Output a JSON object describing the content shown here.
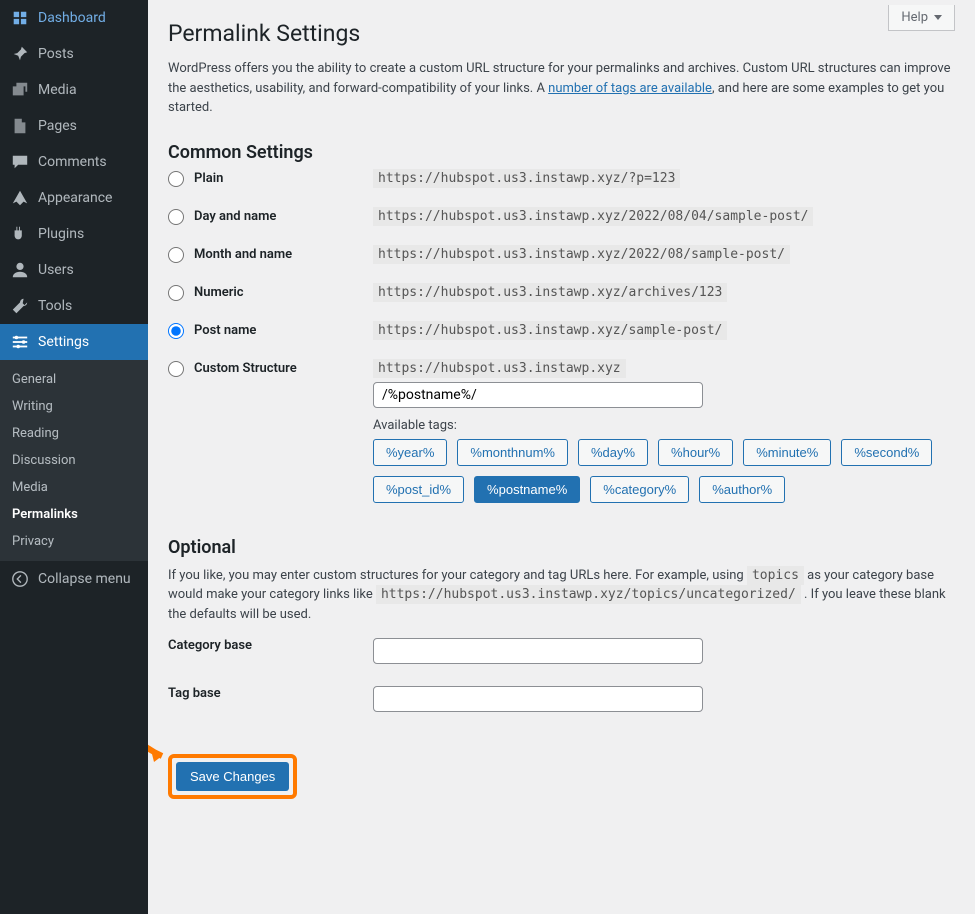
{
  "sidebar": {
    "items": [
      {
        "label": "Dashboard",
        "icon": "dashboard"
      },
      {
        "label": "Posts",
        "icon": "pin"
      },
      {
        "label": "Media",
        "icon": "media"
      },
      {
        "label": "Pages",
        "icon": "pages"
      },
      {
        "label": "Comments",
        "icon": "comments"
      },
      {
        "label": "Appearance",
        "icon": "appearance"
      },
      {
        "label": "Plugins",
        "icon": "plugins"
      },
      {
        "label": "Users",
        "icon": "users"
      },
      {
        "label": "Tools",
        "icon": "tools"
      },
      {
        "label": "Settings",
        "icon": "settings"
      }
    ],
    "submenu": [
      {
        "label": "General"
      },
      {
        "label": "Writing"
      },
      {
        "label": "Reading"
      },
      {
        "label": "Discussion"
      },
      {
        "label": "Media"
      },
      {
        "label": "Permalinks"
      },
      {
        "label": "Privacy"
      }
    ],
    "collapse": "Collapse menu"
  },
  "help": "Help",
  "page": {
    "title": "Permalink Settings",
    "intro_1": "WordPress offers you the ability to create a custom URL structure for your permalinks and archives. Custom URL structures can improve the aesthetics, usability, and forward-compatibility of your links. A ",
    "intro_link": "number of tags are available",
    "intro_2": ", and here are some examples to get you started.",
    "common_heading": "Common Settings",
    "options": {
      "plain": {
        "label": "Plain",
        "url": "https://hubspot.us3.instawp.xyz/?p=123"
      },
      "day": {
        "label": "Day and name",
        "url": "https://hubspot.us3.instawp.xyz/2022/08/04/sample-post/"
      },
      "month": {
        "label": "Month and name",
        "url": "https://hubspot.us3.instawp.xyz/2022/08/sample-post/"
      },
      "numeric": {
        "label": "Numeric",
        "url": "https://hubspot.us3.instawp.xyz/archives/123"
      },
      "post": {
        "label": "Post name",
        "url": "https://hubspot.us3.instawp.xyz/sample-post/"
      },
      "custom": {
        "label": "Custom Structure",
        "url": "https://hubspot.us3.instawp.xyz",
        "value": "/%postname%/"
      }
    },
    "available_tags": "Available tags:",
    "tags1": [
      "%year%",
      "%monthnum%",
      "%day%",
      "%hour%",
      "%minute%",
      "%second%"
    ],
    "tags2": [
      "%post_id%",
      "%postname%",
      "%category%",
      "%author%"
    ],
    "optional_heading": "Optional",
    "optional_p1_a": "If you like, you may enter custom structures for your category and tag URLs here. For example, using ",
    "optional_code": "topics",
    "optional_p1_b": " as your category base would make your category links like ",
    "optional_url": "https://hubspot.us3.instawp.xyz/topics/uncategorized/",
    "optional_p1_c": " . If you leave these blank the defaults will be used.",
    "category_label": "Category base",
    "tag_label": "Tag base",
    "save": "Save Changes"
  }
}
